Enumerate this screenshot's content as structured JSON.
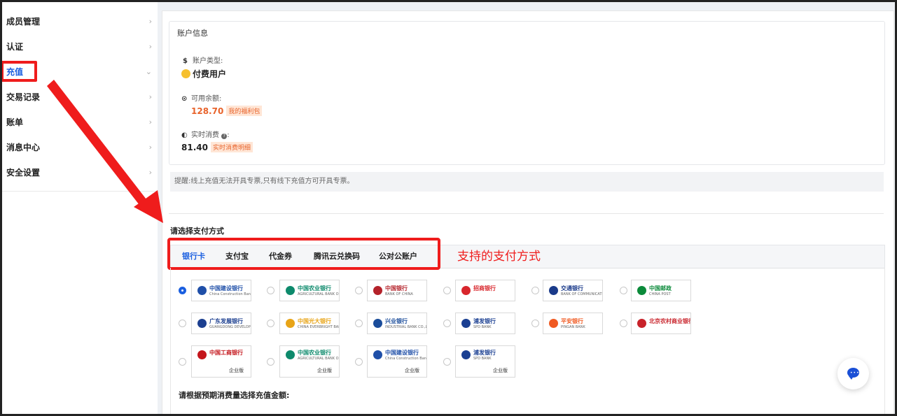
{
  "sidebar": {
    "items": [
      {
        "label": "成员管理",
        "chevron": "›",
        "active": false
      },
      {
        "label": "认证",
        "chevron": "›",
        "active": false
      },
      {
        "label": "充值",
        "chevron": "⌄",
        "active": true
      },
      {
        "label": "交易记录",
        "chevron": "›",
        "active": false
      },
      {
        "label": "账单",
        "chevron": "›",
        "active": false
      },
      {
        "label": "消息中心",
        "chevron": "›",
        "active": false
      },
      {
        "label": "安全设置",
        "chevron": "›",
        "active": false
      }
    ]
  },
  "account": {
    "title": "账户信息",
    "type_label": "账户类型:",
    "type_value": "付费用户",
    "balance_label": "可用余额:",
    "balance_value": "128.70",
    "balance_tag": "我的福利包",
    "spend_label": "实时消费",
    "spend_value": "81.40",
    "spend_tag": "实时消费明细"
  },
  "notice": "提醒:线上充值无法开具专票,只有线下充值方可开具专票。",
  "payment": {
    "title": "请选择支付方式",
    "tabs": [
      {
        "label": "银行卡",
        "active": true
      },
      {
        "label": "支付宝",
        "active": false
      },
      {
        "label": "代金券",
        "active": false
      },
      {
        "label": "腾讯云兑换码",
        "active": false
      },
      {
        "label": "公对公账户",
        "active": false
      }
    ],
    "annotation": "支持的支付方式"
  },
  "banks": [
    {
      "name": "中国建设银行",
      "sub": "China Construction Bank",
      "color": "#1f4fa8",
      "selected": true,
      "enterprise": ""
    },
    {
      "name": "中国农业银行",
      "sub": "AGRICULTURAL BANK OF CHINA",
      "color": "#0d8a6c",
      "selected": false,
      "enterprise": ""
    },
    {
      "name": "中国银行",
      "sub": "BANK OF CHINA",
      "color": "#b4222a",
      "selected": false,
      "enterprise": ""
    },
    {
      "name": "招商银行",
      "sub": "",
      "color": "#d8262c",
      "selected": false,
      "enterprise": ""
    },
    {
      "name": "交通银行",
      "sub": "BANK OF COMMUNICATIONS",
      "color": "#1a3a8a",
      "selected": false,
      "enterprise": ""
    },
    {
      "name": "中国邮政",
      "sub": "CHINA POST",
      "color": "#0b8a3a",
      "selected": false,
      "enterprise": ""
    },
    {
      "name": "广东发展银行",
      "sub": "GUANGDONG DEVELOPMENT BANK",
      "color": "#1c3f90",
      "selected": false,
      "enterprise": ""
    },
    {
      "name": "中国光大银行",
      "sub": "CHINA EVERBRIGHT BANK",
      "color": "#e8a417",
      "selected": false,
      "enterprise": ""
    },
    {
      "name": "兴业银行",
      "sub": "INDUSTRIAL BANK CO.,LTD.",
      "color": "#1a4c9a",
      "selected": false,
      "enterprise": ""
    },
    {
      "name": "浦发银行",
      "sub": "SPD BANK",
      "color": "#1a3f92",
      "selected": false,
      "enterprise": ""
    },
    {
      "name": "平安银行",
      "sub": "PINGAN BANK",
      "color": "#f05a22",
      "selected": false,
      "enterprise": ""
    },
    {
      "name": "北京农村商业银行",
      "sub": "",
      "color": "#c8222a",
      "selected": false,
      "enterprise": ""
    },
    {
      "name": "中国工商银行",
      "sub": "",
      "color": "#c4161c",
      "selected": false,
      "enterprise": "企业版"
    },
    {
      "name": "中国农业银行",
      "sub": "AGRICULTURAL BANK OF CHINA",
      "color": "#0d8a6c",
      "selected": false,
      "enterprise": "企业版"
    },
    {
      "name": "中国建设银行",
      "sub": "China Construction Bank",
      "color": "#1f4fa8",
      "selected": false,
      "enterprise": "企业版"
    },
    {
      "name": "浦发银行",
      "sub": "SPD BANK",
      "color": "#1a3f92",
      "selected": false,
      "enterprise": "企业版"
    }
  ],
  "amount_title": "请根据预期消费量选择充值金额:",
  "icons": {
    "currency": "$",
    "balance": "⊙",
    "spend": "◐",
    "help": "?"
  },
  "colors": {
    "primary": "#1a5fe0",
    "annotation": "#ef1c1c",
    "tag_bg": "#ffe6d6",
    "tag_text": "#e8632b"
  }
}
